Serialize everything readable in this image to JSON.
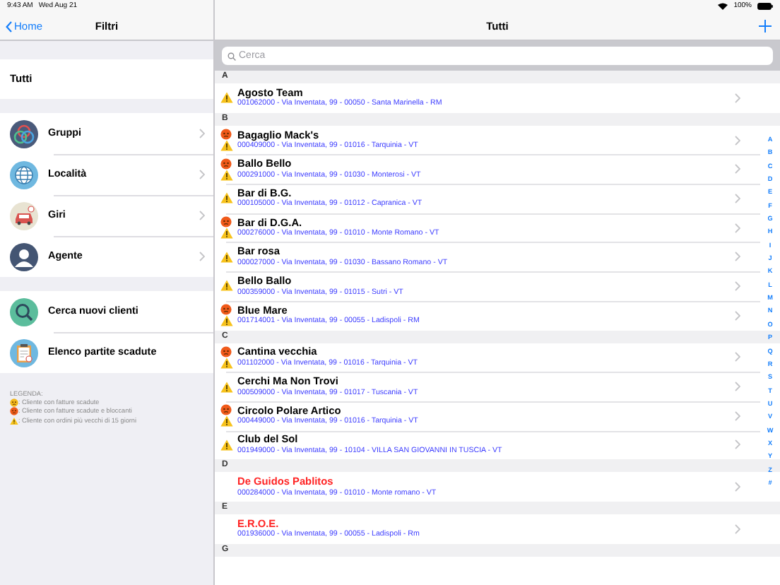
{
  "status_bar": {
    "time": "9:43 AM",
    "date": "Wed Aug 21",
    "battery": "100%"
  },
  "sidebar": {
    "back": "Home",
    "title": "Filtri",
    "all": "Tutti",
    "groups": [
      [
        {
          "label": "Gruppi",
          "kind": "groups",
          "disclosure": true
        },
        {
          "label": "Località",
          "kind": "globe",
          "disclosure": true
        },
        {
          "label": "Giri",
          "kind": "car",
          "disclosure": true
        },
        {
          "label": "Agente",
          "kind": "person",
          "disclosure": true
        }
      ],
      [
        {
          "label": "Cerca nuovi clienti",
          "kind": "search",
          "disclosure": false
        },
        {
          "label": "Elenco partite scadute",
          "kind": "clipboard",
          "disclosure": false
        }
      ]
    ],
    "legend": {
      "title": "LEGENDA:",
      "items": [
        {
          "kind": "overdue",
          "text": ": Cliente con fatture scadute"
        },
        {
          "kind": "blocking",
          "text": ": Cliente con fatture scadute e bloccanti"
        },
        {
          "kind": "old_orders",
          "text": ": Cliente con ordini più vecchi di 15 giorni"
        }
      ]
    }
  },
  "main": {
    "title": "Tutti",
    "search": {
      "placeholder": "Cerca"
    },
    "sections": [
      {
        "letter": "A",
        "rows": [
          {
            "name": "Agosto Team",
            "detail": "001062000 - Via Inventata, 99 - 00050 - Santa Marinella - RM",
            "blocking": false,
            "old_orders": true,
            "flagged": false
          }
        ]
      },
      {
        "letter": "B",
        "rows": [
          {
            "name": "Bagaglio Mack's",
            "detail": "000409000 - Via Inventata, 99 - 01016 - Tarquinia - VT",
            "blocking": true,
            "old_orders": true,
            "flagged": false
          },
          {
            "name": "Ballo Bello",
            "detail": "000291000 - Via Inventata, 99 - 01030 - Monterosi - VT",
            "blocking": true,
            "old_orders": true,
            "flagged": false
          },
          {
            "name": "Bar di B.G.",
            "detail": "000105000 - Via Inventata, 99 - 01012 - Capranica - VT",
            "blocking": false,
            "old_orders": true,
            "flagged": false
          },
          {
            "name": "Bar di D.G.A.",
            "detail": "000276000 - Via Inventata, 99 - 01010 - Monte Romano - VT",
            "blocking": true,
            "old_orders": true,
            "flagged": false
          },
          {
            "name": "Bar rosa",
            "detail": "000027000 - Via Inventata, 99 - 01030 - Bassano Romano - VT",
            "blocking": false,
            "old_orders": true,
            "flagged": false
          },
          {
            "name": "Bello Ballo",
            "detail": "000359000 - Via Inventata, 99 - 01015 - Sutri - VT",
            "blocking": false,
            "old_orders": true,
            "flagged": false
          },
          {
            "name": "Blue Mare",
            "detail": "001714001 - Via Inventata, 99 - 00055 - Ladispoli - RM",
            "blocking": true,
            "old_orders": true,
            "flagged": false
          }
        ]
      },
      {
        "letter": "C",
        "rows": [
          {
            "name": "Cantina vecchia",
            "detail": "001102000 - Via Inventata, 99 - 01016 - Tarquinia - VT",
            "blocking": true,
            "old_orders": true,
            "flagged": false
          },
          {
            "name": "Cerchi Ma Non Trovi",
            "detail": "000509000 - Via Inventata, 99 - 01017 - Tuscania - VT",
            "blocking": false,
            "old_orders": true,
            "flagged": false
          },
          {
            "name": "Circolo Polare Artico",
            "detail": "000449000 - Via Inventata, 99 - 01016 - Tarquinia - VT",
            "blocking": true,
            "old_orders": true,
            "flagged": false
          },
          {
            "name": "Club del Sol",
            "detail": "001949000 - Via Inventata, 99 - 10104 - VILLA SAN GIOVANNI IN TUSCIA - VT",
            "blocking": false,
            "old_orders": true,
            "flagged": false
          }
        ]
      },
      {
        "letter": "D",
        "rows": [
          {
            "name": "De Guidos Pablitos",
            "detail": "000284000 - Via Inventata, 99 - 01010 - Monte romano - VT",
            "blocking": false,
            "old_orders": false,
            "flagged": true
          }
        ]
      },
      {
        "letter": "E",
        "rows": [
          {
            "name": "E.R.O.E.",
            "detail": "001936000 - Via Inventata, 99 - 00055 - Ladispoli - Rm",
            "blocking": false,
            "old_orders": false,
            "flagged": true
          }
        ]
      },
      {
        "letter": "G"
      }
    ],
    "index": [
      "A",
      "B",
      "C",
      "D",
      "E",
      "F",
      "G",
      "H",
      "I",
      "J",
      "K",
      "L",
      "M",
      "N",
      "O",
      "P",
      "Q",
      "R",
      "S",
      "T",
      "U",
      "V",
      "W",
      "X",
      "Y",
      "Z",
      "#"
    ]
  }
}
